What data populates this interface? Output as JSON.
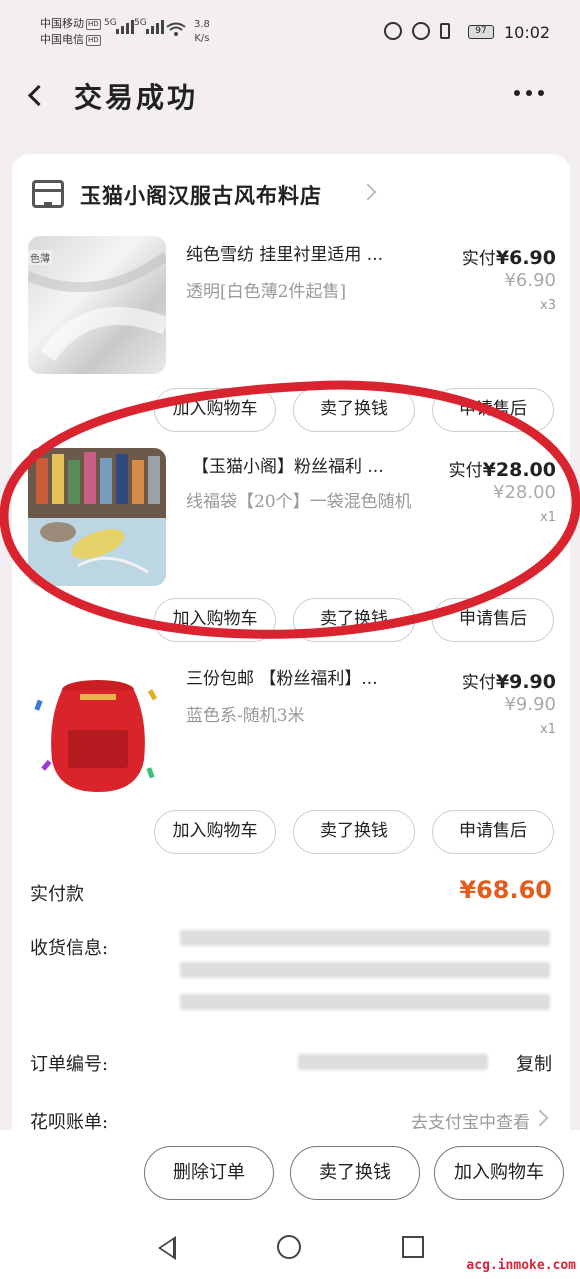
{
  "status_bar": {
    "carrier1": "中国移动",
    "carrier2": "中国电信",
    "hd_badge": "HD",
    "net1": "5G",
    "net2": "5G",
    "speed_value": "3.8",
    "speed_unit": "K/s",
    "battery": "97",
    "time": "10:02"
  },
  "header": {
    "title": "交易成功"
  },
  "shop": {
    "name": "玉猫小阁汉服古风布料店"
  },
  "items": [
    {
      "title": "纯色雪纺 挂里衬里适用 ...",
      "sku": "透明[白色薄2件起售]",
      "paid_label": "实付",
      "paid_price": "¥6.90",
      "orig_price": "¥6.90",
      "qty": "x3",
      "thumb_tag": "色薄"
    },
    {
      "title": "【玉猫小阁】粉丝福利 ...",
      "sku": "线福袋【20个】一袋混色随机",
      "paid_label": "实付",
      "paid_price": "¥28.00",
      "orig_price": "¥28.00",
      "qty": "x1"
    },
    {
      "title": "三份包邮 【粉丝福利】...",
      "sku": "蓝色系-随机3米",
      "paid_label": "实付",
      "paid_price": "¥9.90",
      "orig_price": "¥9.90",
      "qty": "x1"
    }
  ],
  "item_buttons": {
    "add_cart": "加入购物车",
    "resell": "卖了换钱",
    "after_sale": "申请售后"
  },
  "summary": {
    "paid_label": "实付款",
    "paid_total": "¥68.60",
    "shipping_label": "收货信息:",
    "order_no_label": "订单编号:",
    "copy": "复制",
    "huabei_label": "花呗账单:",
    "huabei_link": "去支付宝中查看"
  },
  "bottom_actions": {
    "delete": "删除订单",
    "resell": "卖了换钱",
    "add_cart": "加入购物车"
  },
  "watermark": "acg.inmoke.com",
  "colors": {
    "price_accent": "#e25c1c",
    "circle": "#d9232e",
    "background": "#f3eef2"
  }
}
